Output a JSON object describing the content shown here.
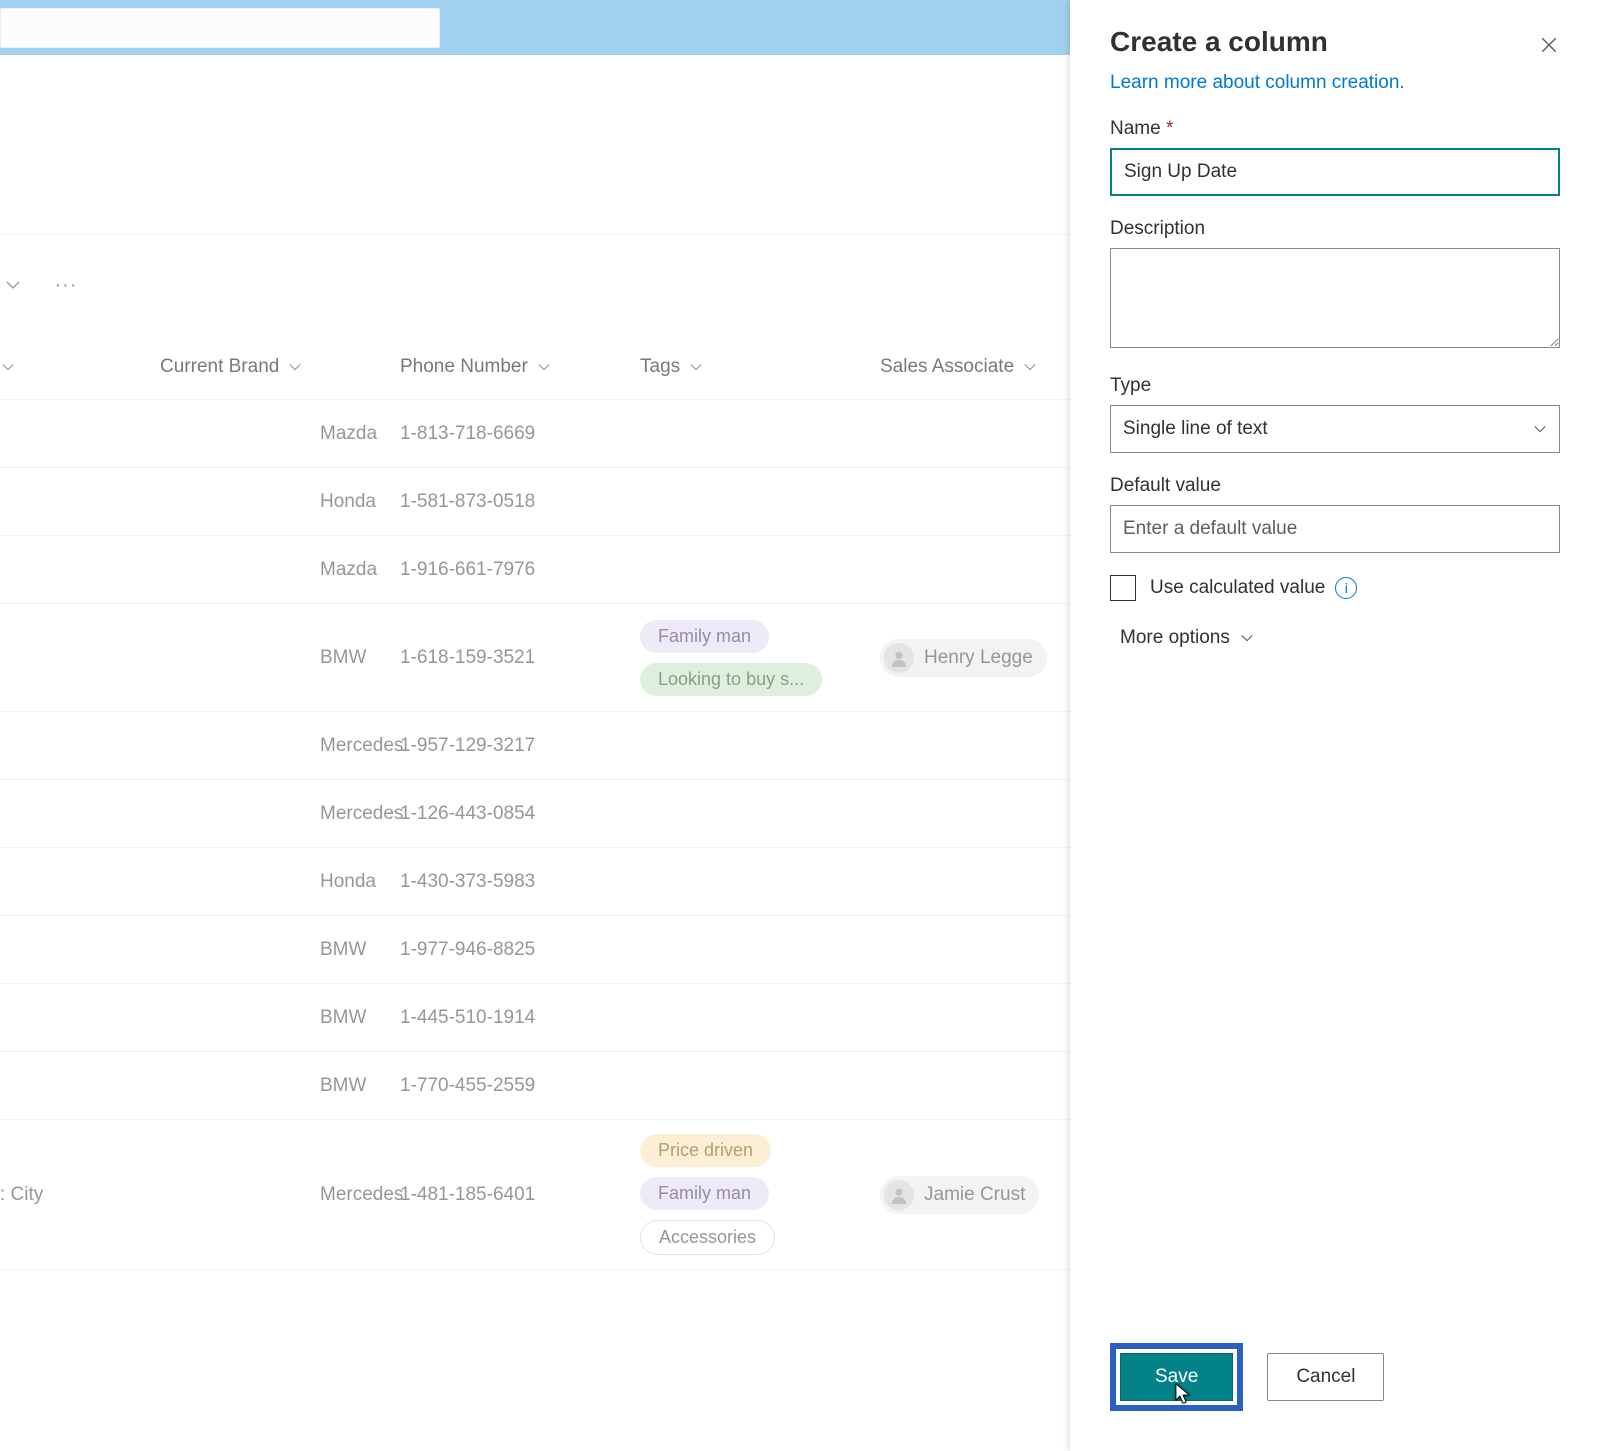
{
  "panel": {
    "title": "Create a column",
    "learn_more": "Learn more about column creation.",
    "name_label": "Name",
    "name_required_marker": "*",
    "name_value": "Sign Up Date",
    "description_label": "Description",
    "description_value": "",
    "type_label": "Type",
    "type_value": "Single line of text",
    "default_label": "Default value",
    "default_placeholder": "Enter a default value",
    "default_value": "",
    "calculated_label": "Use calculated value",
    "more_options": "More options",
    "save_label": "Save",
    "cancel_label": "Cancel"
  },
  "columns": {
    "col0": "",
    "col1": "Current Brand",
    "col2": "Phone Number",
    "col3": "Tags",
    "col4": "Sales Associate"
  },
  "rows": [
    {
      "c0": "",
      "brand": "Mazda",
      "phone": "1-813-718-6669",
      "tags": [],
      "assoc": ""
    },
    {
      "c0": "",
      "brand": "Honda",
      "phone": "1-581-873-0518",
      "tags": [],
      "assoc": ""
    },
    {
      "c0": "",
      "brand": "Mazda",
      "phone": "1-916-661-7976",
      "tags": [],
      "assoc": ""
    },
    {
      "c0": "",
      "brand": "BMW",
      "phone": "1-618-159-3521",
      "tags": [
        {
          "text": "Family man",
          "kind": "purple"
        },
        {
          "text": "Looking to buy s...",
          "kind": "green"
        }
      ],
      "assoc": "Henry Legge"
    },
    {
      "c0": "",
      "brand": "Mercedes",
      "phone": "1-957-129-3217",
      "tags": [],
      "assoc": ""
    },
    {
      "c0": "",
      "brand": "Mercedes",
      "phone": "1-126-443-0854",
      "tags": [],
      "assoc": ""
    },
    {
      "c0": "",
      "brand": "Honda",
      "phone": "1-430-373-5983",
      "tags": [],
      "assoc": ""
    },
    {
      "c0": "",
      "brand": "BMW",
      "phone": "1-977-946-8825",
      "tags": [],
      "assoc": ""
    },
    {
      "c0": "",
      "brand": "BMW",
      "phone": "1-445-510-1914",
      "tags": [],
      "assoc": ""
    },
    {
      "c0": "",
      "brand": "BMW",
      "phone": "1-770-455-2559",
      "tags": [],
      "assoc": ""
    },
    {
      "c0": ": City",
      "brand": "Mercedes",
      "phone": "1-481-185-6401",
      "tags": [
        {
          "text": "Price driven",
          "kind": "orange"
        },
        {
          "text": "Family man",
          "kind": "purple"
        },
        {
          "text": "Accessories",
          "kind": "grey"
        }
      ],
      "assoc": "Jamie Crust"
    }
  ]
}
